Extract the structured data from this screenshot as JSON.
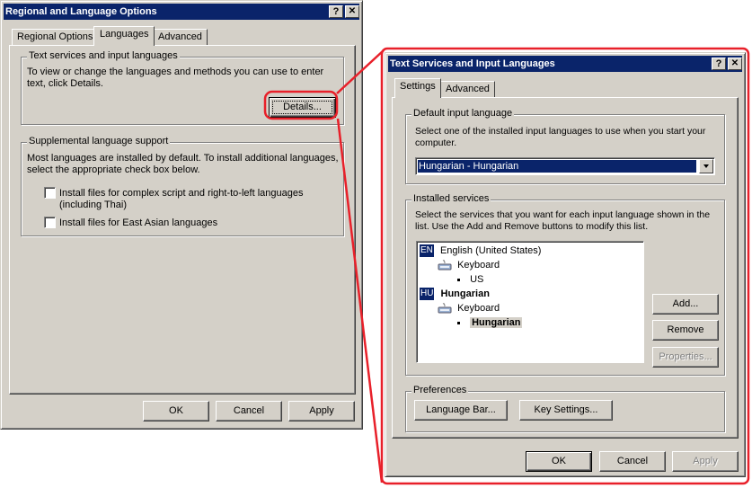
{
  "left_dialog": {
    "title": "Regional and Language Options",
    "help_button": "?",
    "close_button": "✕",
    "tabs": [
      {
        "label": "Regional Options",
        "active": false
      },
      {
        "label": "Languages",
        "active": true
      },
      {
        "label": "Advanced",
        "active": false
      }
    ],
    "text_services_group": {
      "label": "Text services and input languages",
      "description_line1": "To view or change the languages and methods you can use to enter",
      "description_line2": "text, click Details.",
      "details_button": "Details..."
    },
    "supplemental_group": {
      "label": "Supplemental language support",
      "description_line1": "Most languages are installed by default. To install additional languages,",
      "description_line2": "select the appropriate check box below.",
      "checkboxes": [
        {
          "label_line1": "Install files for complex script and right-to-left languages",
          "label_line2": "(including Thai)",
          "checked": false
        },
        {
          "label_line1": "Install files for East Asian languages",
          "checked": false
        }
      ]
    },
    "buttons": {
      "ok": "OK",
      "cancel": "Cancel",
      "apply": "Apply"
    }
  },
  "right_dialog": {
    "title": "Text Services and Input Languages",
    "help_button": "?",
    "close_button": "✕",
    "tabs": [
      {
        "label": "Settings",
        "active": true
      },
      {
        "label": "Advanced",
        "active": false
      }
    ],
    "default_input_group": {
      "label": "Default input language",
      "description_line1": "Select one of the installed input languages to use when you start your",
      "description_line2": "computer.",
      "selected_value": "Hungarian - Hungarian"
    },
    "installed_services_group": {
      "label": "Installed services",
      "description_line1": "Select the services that you want for each input language shown in the",
      "description_line2": "list. Use the Add and Remove buttons to modify this list.",
      "tree": [
        {
          "badge": "EN",
          "language": "English (United States)",
          "bold": false,
          "service": "Keyboard",
          "layout": "US",
          "layout_selected": false
        },
        {
          "badge": "HU",
          "language": "Hungarian",
          "bold": true,
          "service": "Keyboard",
          "layout": "Hungarian",
          "layout_selected": true
        }
      ],
      "add_button": "Add...",
      "remove_button": "Remove",
      "properties_button": "Properties..."
    },
    "preferences_group": {
      "label": "Preferences",
      "language_bar_button": "Language Bar...",
      "key_settings_button": "Key Settings..."
    },
    "buttons": {
      "ok": "OK",
      "cancel": "Cancel",
      "apply": "Apply"
    }
  },
  "annotation": {
    "color": "#e8202a"
  }
}
